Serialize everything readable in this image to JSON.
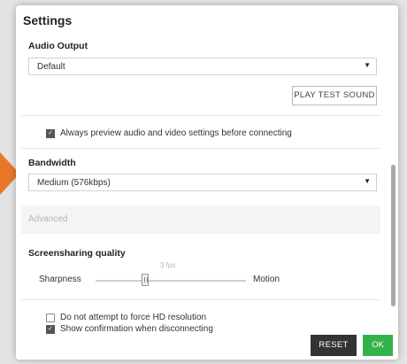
{
  "dialog": {
    "title": "Settings"
  },
  "audio": {
    "label": "Audio Output",
    "selected": "Default",
    "test_button": "PLAY TEST SOUND"
  },
  "preview": {
    "label": "Always preview audio and video settings before connecting",
    "checked": true
  },
  "bandwidth": {
    "label": "Bandwidth",
    "selected": "Medium (576kbps)"
  },
  "advanced": {
    "label": "Advanced"
  },
  "screensharing": {
    "label": "Screensharing quality",
    "left_label": "Sharpness",
    "right_label": "Motion",
    "value_label": "3 fps",
    "level": 0.33
  },
  "options": [
    {
      "label": "Do not attempt to force HD resolution",
      "checked": false
    },
    {
      "label": "Show confirmation when disconnecting",
      "checked": true
    }
  ],
  "footer": {
    "reset_label": "RESET",
    "ok_label": "OK"
  },
  "colors": {
    "accent_ok": "#34b24a",
    "reset_bg": "#333333",
    "arrow": "#e8772a"
  },
  "icons": {
    "dropdown": "chevron-down-icon",
    "check": "checkmark-icon",
    "arrow": "pointer-arrow-icon"
  }
}
